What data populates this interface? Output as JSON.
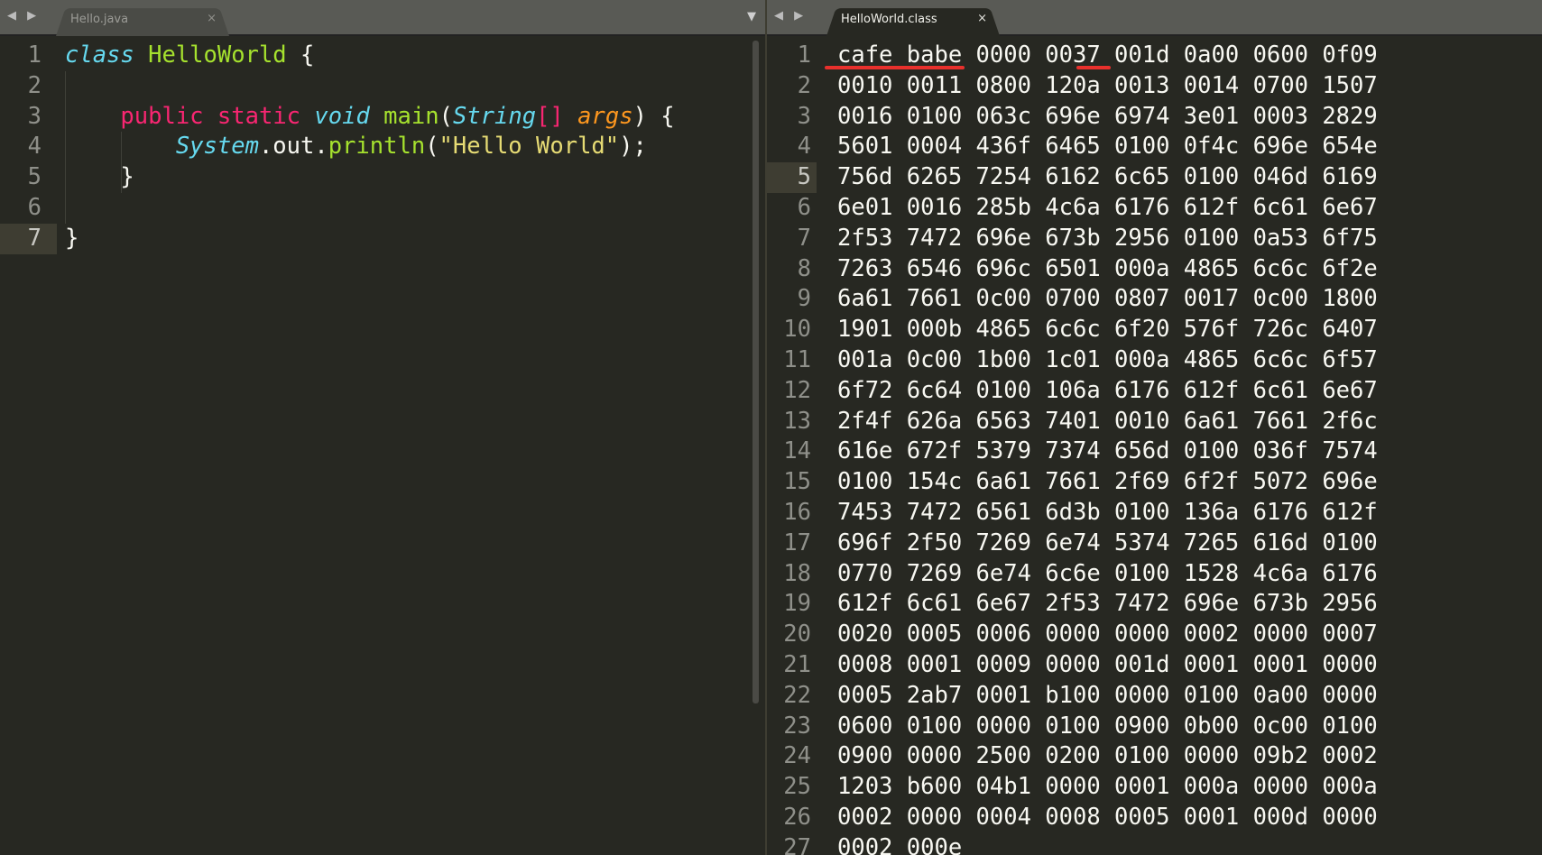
{
  "left": {
    "nav_arrows": "◀ ▶",
    "tab": {
      "label": "Hello.java",
      "close": "×"
    },
    "dropdown": "▼",
    "current_line": 7,
    "lines": [
      {
        "n": "1",
        "tokens": [
          [
            "kw",
            "class"
          ],
          [
            "plain",
            " "
          ],
          [
            "cls",
            "HelloWorld"
          ],
          [
            "plain",
            " {"
          ]
        ]
      },
      {
        "n": "2",
        "tokens": []
      },
      {
        "n": "3",
        "tokens": [
          [
            "plain",
            "    "
          ],
          [
            "mod",
            "public"
          ],
          [
            "plain",
            " "
          ],
          [
            "mod",
            "static"
          ],
          [
            "plain",
            " "
          ],
          [
            "type",
            "void"
          ],
          [
            "plain",
            " "
          ],
          [
            "fn",
            "main"
          ],
          [
            "plain",
            "("
          ],
          [
            "type",
            "String"
          ],
          [
            "brk",
            "[]"
          ],
          [
            "plain",
            " "
          ],
          [
            "arg",
            "args"
          ],
          [
            "plain",
            ") {"
          ]
        ]
      },
      {
        "n": "4",
        "tokens": [
          [
            "plain",
            "        "
          ],
          [
            "type",
            "System"
          ],
          [
            "plain",
            ".out."
          ],
          [
            "fn",
            "println"
          ],
          [
            "plain",
            "("
          ],
          [
            "str",
            "\"Hello World\""
          ],
          [
            "plain",
            ");"
          ]
        ]
      },
      {
        "n": "5",
        "tokens": [
          [
            "plain",
            "    }"
          ]
        ]
      },
      {
        "n": "6",
        "tokens": []
      },
      {
        "n": "7",
        "tokens": [
          [
            "plain",
            "}"
          ]
        ]
      }
    ]
  },
  "right": {
    "nav_arrows": "◀ ▶",
    "tab": {
      "label": "HelloWorld.class",
      "close": "×"
    },
    "current_line": 5,
    "lines": [
      "cafe babe 0000 0037 001d 0a00 0600 0f09",
      "0010 0011 0800 120a 0013 0014 0700 1507",
      "0016 0100 063c 696e 6974 3e01 0003 2829",
      "5601 0004 436f 6465 0100 0f4c 696e 654e",
      "756d 6265 7254 6162 6c65 0100 046d 6169",
      "6e01 0016 285b 4c6a 6176 612f 6c61 6e67",
      "2f53 7472 696e 673b 2956 0100 0a53 6f75",
      "7263 6546 696c 6501 000a 4865 6c6c 6f2e",
      "6a61 7661 0c00 0700 0807 0017 0c00 1800",
      "1901 000b 4865 6c6c 6f20 576f 726c 6407",
      "001a 0c00 1b00 1c01 000a 4865 6c6c 6f57",
      "6f72 6c64 0100 106a 6176 612f 6c61 6e67",
      "2f4f 626a 6563 7401 0010 6a61 7661 2f6c",
      "616e 672f 5379 7374 656d 0100 036f 7574",
      "0100 154c 6a61 7661 2f69 6f2f 5072 696e",
      "7453 7472 6561 6d3b 0100 136a 6176 612f",
      "696f 2f50 7269 6e74 5374 7265 616d 0100",
      "0770 7269 6e74 6c6e 0100 1528 4c6a 6176",
      "612f 6c61 6e67 2f53 7472 696e 673b 2956",
      "0020 0005 0006 0000 0000 0002 0000 0007",
      "0008 0001 0009 0000 001d 0001 0001 0000",
      "0005 2ab7 0001 b100 0000 0100 0a00 0000",
      "0600 0100 0000 0100 0900 0b00 0c00 0100",
      "0900 0000 2500 0200 0100 0000 09b2 0002",
      "1203 b600 04b1 0000 0001 000a 0000 000a",
      "0002 0000 0004 0008 0005 0001 000d 0000",
      "0002 000e"
    ]
  },
  "colors": {
    "background": "#272822",
    "annotation_underline": "#e8302c"
  }
}
